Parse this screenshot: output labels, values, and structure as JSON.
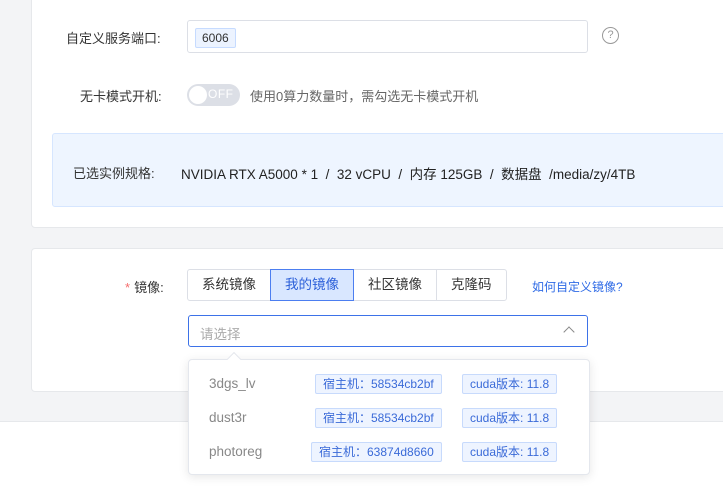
{
  "port": {
    "label": "自定义服务端口:",
    "value": "6006",
    "help_icon": "?"
  },
  "nocard": {
    "label": "无卡模式开机:",
    "toggle_text": "OFF",
    "toggle_on": false,
    "hint": "使用0算力数量时，需勾选无卡模式开机"
  },
  "spec": {
    "label": "已选实例规格:",
    "value": "NVIDIA RTX A5000 * 1  /  32 vCPU  /  内存 125GB  /  数据盘  /media/zy/4TB"
  },
  "image": {
    "required_mark": "*",
    "label": "镜像:",
    "tabs": [
      "系统镜像",
      "我的镜像",
      "社区镜像",
      "克隆码"
    ],
    "active_tab": 1,
    "custom_link": "如何自定义镜像?",
    "select_placeholder": "请选择",
    "options": [
      {
        "name": "3dgs_lv",
        "host": "宿主机：58534cb2bf",
        "cuda": "cuda版本: 11.8"
      },
      {
        "name": "dust3r",
        "host": "宿主机：58534cb2bf",
        "cuda": "cuda版本: 11.8"
      },
      {
        "name": "photoreg",
        "host": "宿主机：63874d8660",
        "cuda": "cuda版本: 11.8"
      }
    ]
  },
  "colors": {
    "accent": "#3d72e8",
    "active_tab_bg": "#d9e7ff",
    "spec_bg": "#eef5ff",
    "required": "#f56c6c"
  }
}
